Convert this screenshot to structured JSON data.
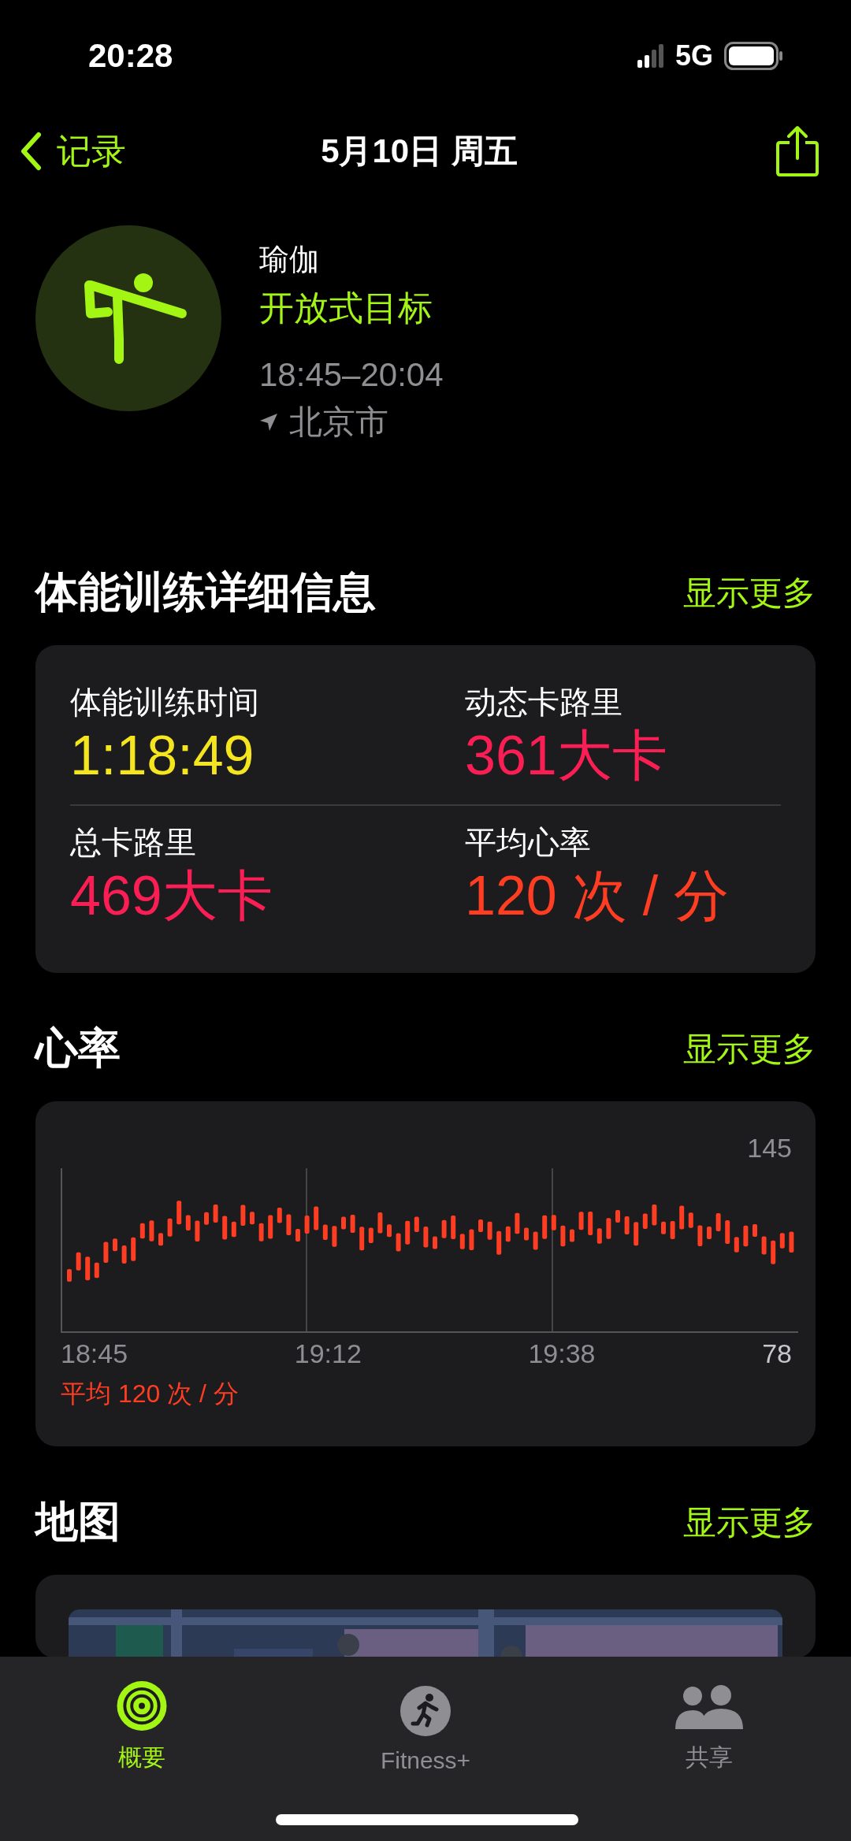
{
  "status_bar": {
    "time": "20:28",
    "network": "5G"
  },
  "nav": {
    "back_label": "记录",
    "title": "5月10日 周五"
  },
  "workout": {
    "name": "瑜伽",
    "goal": "开放式目标",
    "time_range": "18:45–20:04",
    "location": "北京市"
  },
  "details": {
    "title": "体能训练详细信息",
    "more": "显示更多",
    "metrics": [
      {
        "label": "体能训练时间",
        "value": "1:18:49",
        "color": "#f4e51e"
      },
      {
        "label": "动态卡路里",
        "value": "361大卡",
        "color": "#fa1e55"
      },
      {
        "label": "总卡路里",
        "value": "469大卡",
        "color": "#fa1e55"
      },
      {
        "label": "平均心率",
        "value": "120 次 / 分",
        "color": "#ff3d22"
      }
    ]
  },
  "heart_rate": {
    "title": "心率",
    "more": "显示更多",
    "max": "145",
    "min": "78",
    "x_labels": [
      "18:45",
      "19:12",
      "19:38"
    ],
    "average": "平均 120 次 / 分"
  },
  "map": {
    "title": "地图",
    "more": "显示更多",
    "kind": "picture"
  },
  "tabs": [
    {
      "label": "概要",
      "kind": "rings",
      "selected": true
    },
    {
      "label": "Fitness+",
      "kind": "runner",
      "selected": false
    },
    {
      "label": "共享",
      "kind": "people",
      "selected": false
    }
  ]
}
